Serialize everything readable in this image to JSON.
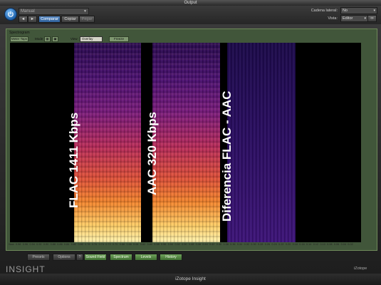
{
  "window": {
    "title": "Output",
    "footer_title": "iZotope Insight"
  },
  "host": {
    "preset": "Manual",
    "buttons": {
      "prev": "◄",
      "next": "►",
      "compare": "Comparar",
      "copy": "Copiar",
      "paste": "Pegar"
    },
    "sidechain_label": "Cadena lateral:",
    "sidechain_value": "No",
    "view_label": "Vista:",
    "view_value": "Editor",
    "link_icon": "link-icon"
  },
  "plugin": {
    "panel_title": "Spectrogram",
    "toolbar": {
      "meter_taps": "Meter Taps",
      "mode_label": "Mode",
      "view_label": "View",
      "view_value": "Overlay",
      "freeze": "Freeze"
    },
    "overlay_labels": [
      "FLAC 1411 Kbps",
      "AAC 320 Kbps",
      "Diferencia FLAC - AAC"
    ],
    "freq_axis": [
      "20000",
      "17000",
      "15000",
      "13000",
      "11000",
      "10000",
      "9000",
      "8000",
      "7000",
      "6000",
      "5000",
      "4000",
      "3500",
      "3000",
      "2500",
      "2000",
      "1500",
      "1000",
      "700",
      "500",
      "300",
      "200",
      "100",
      "70"
    ],
    "time_axis": [
      "Now",
      "0.98",
      "0.96",
      "0.94",
      "0.92",
      "0.90",
      "0.88",
      "0.86",
      "0.84",
      "0.82",
      "0.80",
      "0.78",
      "0.76",
      "0.74",
      "0.72",
      "0.70",
      "0.68",
      "0.66",
      "0.64",
      "0.62",
      "0.60",
      "0.58",
      "0.56",
      "0.54",
      "0.52",
      "0.50",
      "0.48",
      "0.46",
      "0.44",
      "0.42",
      "0.40",
      "0.38",
      "0.36",
      "0.34",
      "0.32",
      "0.30",
      "0.28",
      "0.26",
      "0.24",
      "0.22",
      "0.20",
      "0.18",
      "0.16",
      "0.14",
      "0.12",
      "0.10",
      "0.08",
      "0.06",
      "0.04",
      "0.02"
    ],
    "bottom_buttons": {
      "presets": "Presets",
      "options": "Options",
      "help": "?",
      "sound_field": "Sound Field",
      "spectrum": "Spectrum",
      "levels": "Levels",
      "history": "History"
    },
    "brand": "INSIGHT",
    "izotope_logo": "iZotope"
  },
  "colors": {
    "panel": "#41563a",
    "accent_green": "#6fa35c",
    "compare_blue": "#3f73b4"
  }
}
